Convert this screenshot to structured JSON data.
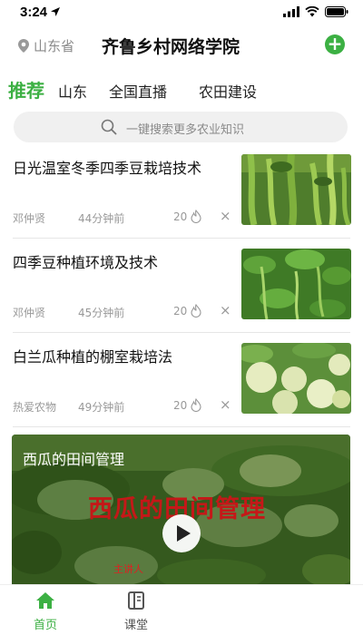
{
  "status_bar": {
    "time": "3:24"
  },
  "header": {
    "location": "山东省",
    "title": "齐鲁乡村网络学院",
    "add_icon": "plus-icon"
  },
  "tabs": [
    {
      "label": "推荐",
      "active": true
    },
    {
      "label": "山东",
      "active": false
    },
    {
      "label": "全国直播",
      "active": false
    },
    {
      "label": "农田建设",
      "active": false
    }
  ],
  "search": {
    "placeholder": "一键搜索更多农业知识"
  },
  "articles": [
    {
      "title": "日光温室冬季四季豆栽培技术",
      "author": "邓仲贤",
      "time": "44分钟前",
      "hot": "20"
    },
    {
      "title": "四季豆种植环境及技术",
      "author": "邓仲贤",
      "time": "45分钟前",
      "hot": "20"
    },
    {
      "title": "白兰瓜种植的棚室栽培法",
      "author": "热爱农物",
      "time": "49分钟前",
      "hot": "20"
    }
  ],
  "video": {
    "label": "西瓜的田间管理",
    "overlay_title": "西瓜的田间管理",
    "credit": "主讲人"
  },
  "tabbar": [
    {
      "label": "首页",
      "active": true
    },
    {
      "label": "课堂",
      "active": false
    }
  ],
  "colors": {
    "accent": "#3cb043",
    "overlay_red": "#c41818"
  }
}
